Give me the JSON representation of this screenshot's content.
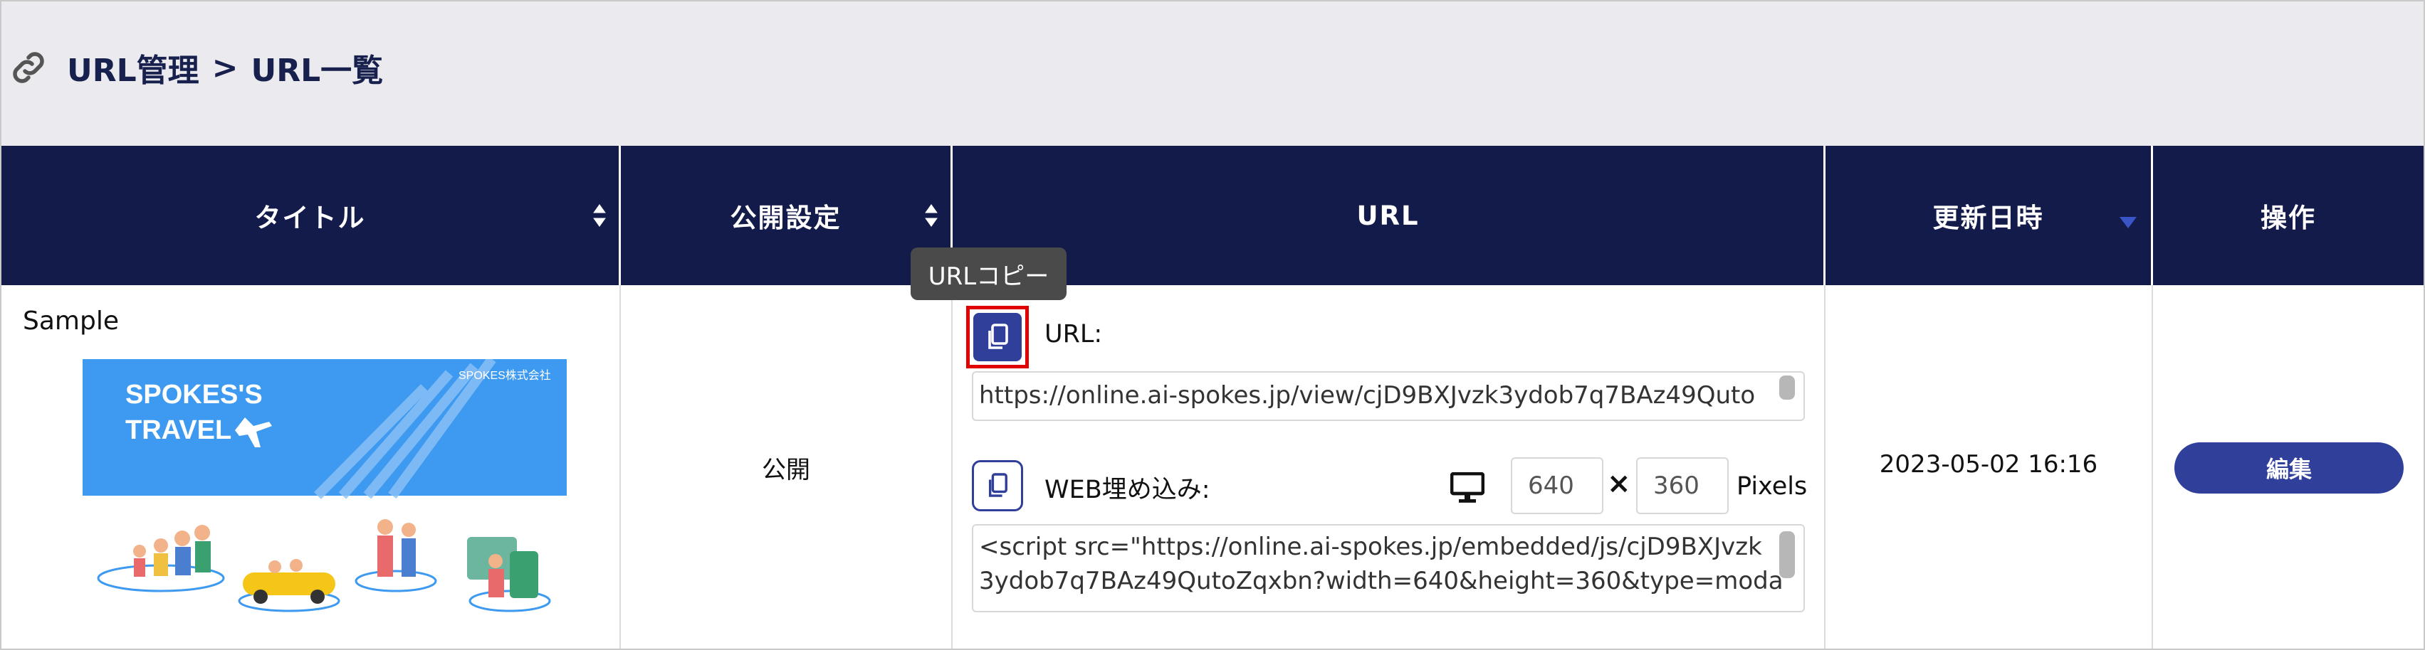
{
  "breadcrumb": {
    "root": "URL管理",
    "separator": ">",
    "current": "URL一覧"
  },
  "table": {
    "headers": {
      "title": "タイトル",
      "publish": "公開設定",
      "url": "URL",
      "updated": "更新日時",
      "actions": "操作"
    },
    "rows": [
      {
        "title": "Sample",
        "thumbnail": {
          "heading_line1": "SPOKES'S",
          "heading_line2": "TRAVEL",
          "company": "SPOKES株式会社"
        },
        "publish": "公開",
        "url_label": "URL:",
        "url_value": "https://online.ai-spokes.jp/view/cjD9BXJvzk3ydob7q7BAz49Quto",
        "embed_label": "WEB埋め込み:",
        "embed_width": "640",
        "times": "×",
        "embed_height": "360",
        "pixels": "Pixels",
        "embed_code_line1": "<script src=\"https://online.ai-spokes.jp/embedded/js/cjD9BXJvzk",
        "embed_code_line2": "3ydob7q7BAz49QutoZqxbn?width=640&height=360&type=moda",
        "updated": "2023-05-02 16:16",
        "edit_label": "編集"
      }
    ]
  },
  "tooltip": "URLコピー",
  "colors": {
    "header_bg": "#131b4a",
    "accent": "#2f3f9a",
    "topbar_bg": "#ebebef",
    "highlight": "#e00000",
    "thumb_banner": "#3d9af0"
  },
  "icons": [
    "link-icon",
    "chevron-right-icon",
    "sort-icon",
    "sort-desc-icon",
    "copy-icon",
    "monitor-icon"
  ]
}
